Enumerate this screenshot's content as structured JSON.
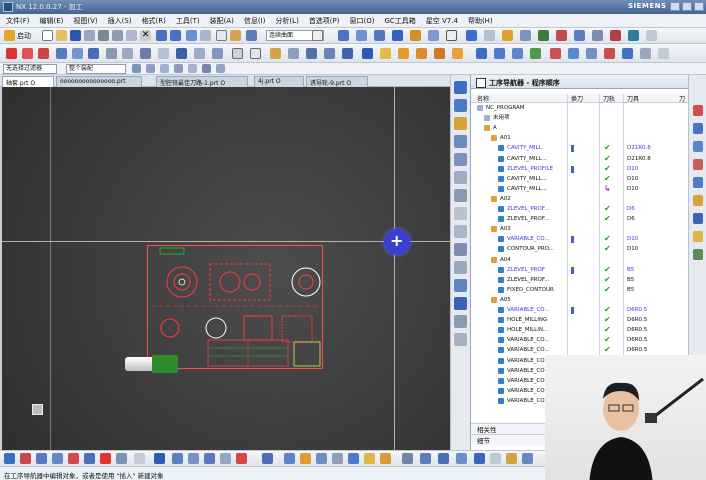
{
  "titlebar": {
    "title": "NX 12.0.0.27 - 加工",
    "brand": "SIEMENS"
  },
  "menu": [
    "文件(F)",
    "编辑(E)",
    "视图(V)",
    "插入(S)",
    "格式(R)",
    "工具(T)",
    "装配(A)",
    "信息(I)",
    "分析(L)",
    "首选项(P)",
    "窗口(O)",
    "GC工具箱",
    "星空 V7.4",
    "帮助(H)"
  ],
  "toolbar": {
    "start_label": "启动",
    "view_combo": "连续曲面"
  },
  "filterbar": {
    "filter_combo": "无选择过滤器",
    "assembly_combo": "整个装配"
  },
  "tabs": [
    "轴套.prt O",
    "ooooooooooooooo.prt",
    "型腔铣最佳刀路-1.prt O",
    "4j.prt O",
    "诱导轮-9.prt O"
  ],
  "navigator": {
    "title": "工序导航器 - 程序顺序",
    "columns": {
      "name": "名称",
      "toolchange": "换刀",
      "path": "刀轨",
      "tool": "刀具",
      "more": "刀"
    },
    "rows": [
      {
        "name": "NC_PROGRAM",
        "indent": 0,
        "style": "plain"
      },
      {
        "name": "未用项",
        "indent": 1,
        "style": "plain"
      },
      {
        "name": "A",
        "indent": 1,
        "style": "group"
      },
      {
        "name": "A01",
        "indent": 2,
        "style": "group"
      },
      {
        "name": "CAVITY_MILL",
        "indent": 3,
        "style": "op-blue",
        "tp": true,
        "check": "ok",
        "tool": "D21R0.8",
        "toolblue": true
      },
      {
        "name": "CAVITY_MILL...",
        "indent": 3,
        "style": "op",
        "check": "ok",
        "tool": "D21R0.8"
      },
      {
        "name": "ZLEVEL_PROFILE",
        "indent": 3,
        "style": "op-blue",
        "tp": true,
        "check": "ok",
        "tool": "D10",
        "toolblue": true
      },
      {
        "name": "CAVITY_MILL...",
        "indent": 3,
        "style": "op",
        "check": "ok",
        "tool": "D10"
      },
      {
        "name": "CAVITY_MILL...",
        "indent": 3,
        "style": "op",
        "check": "arrow",
        "tool": "D10"
      },
      {
        "name": "A02",
        "indent": 2,
        "style": "group"
      },
      {
        "name": "ZLEVEL_PROF...",
        "indent": 3,
        "style": "op-blue",
        "check": "ok",
        "tool": "D6",
        "toolblue": true
      },
      {
        "name": "ZLEVEL_PROF...",
        "indent": 3,
        "style": "op",
        "check": "ok",
        "tool": "D6"
      },
      {
        "name": "A03",
        "indent": 2,
        "style": "group"
      },
      {
        "name": "VARIABLE_CO...",
        "indent": 3,
        "style": "op-blue",
        "tp": true,
        "check": "ok",
        "tool": "D10",
        "toolblue": true
      },
      {
        "name": "CONTOUR_PRO...",
        "indent": 3,
        "style": "op",
        "check": "ok",
        "tool": "D10"
      },
      {
        "name": "A04",
        "indent": 2,
        "style": "group"
      },
      {
        "name": "ZLEVEL_PROF",
        "indent": 3,
        "style": "op-blue",
        "tp": true,
        "check": "ok",
        "tool": "B5",
        "toolblue": true
      },
      {
        "name": "ZLEVEL_PROF...",
        "indent": 3,
        "style": "op",
        "check": "ok",
        "tool": "B5"
      },
      {
        "name": "FIXED_CONTOUR",
        "indent": 3,
        "style": "op",
        "check": "ok",
        "tool": "B5"
      },
      {
        "name": "A05",
        "indent": 2,
        "style": "group"
      },
      {
        "name": "VARIABLE_CO...",
        "indent": 3,
        "style": "op-blue",
        "tp": true,
        "check": "ok",
        "tool": "D6R0.5",
        "toolblue": true
      },
      {
        "name": "HOLE_MILLING",
        "indent": 3,
        "style": "op",
        "check": "ok",
        "tool": "D6R0.5"
      },
      {
        "name": "HOLE_MILLIN...",
        "indent": 3,
        "style": "op",
        "check": "ok",
        "tool": "D6R0.5"
      },
      {
        "name": "VARIABLE_CO...",
        "indent": 3,
        "style": "op",
        "check": "ok",
        "tool": "D6R0.5"
      },
      {
        "name": "VARIABLE_CO...",
        "indent": 3,
        "style": "op",
        "check": "ok",
        "tool": "D6R0.5"
      },
      {
        "name": "VARIABLE_CO...",
        "indent": 3,
        "style": "op",
        "check": "ok",
        "tool": "D6R0.5"
      },
      {
        "name": "VARIABLE_CO...",
        "indent": 3,
        "style": "op",
        "check": "ok",
        "tool": "D6R0.5"
      },
      {
        "name": "VARIABLE_CO...",
        "indent": 3,
        "style": "op",
        "check": "ok",
        "tool": "D6R0.5"
      },
      {
        "name": "VARIABLE_CO...",
        "indent": 3,
        "style": "op",
        "check": "ok",
        "tool": "D6R0.5"
      },
      {
        "name": "VARIABLE_CO...",
        "indent": 3,
        "style": "op",
        "check": "ok",
        "tool": "D6R0.5"
      }
    ],
    "footer_dependencies": "相关性",
    "footer_details": "细节"
  },
  "status": "在工序导航器中编辑对象，或者是使用 \"插入\" 新建对象",
  "colors": {
    "accent": "#3b3bd6",
    "ok": "#18a318",
    "drawing": "#ff3030",
    "viewport": "#3c3c3c"
  }
}
